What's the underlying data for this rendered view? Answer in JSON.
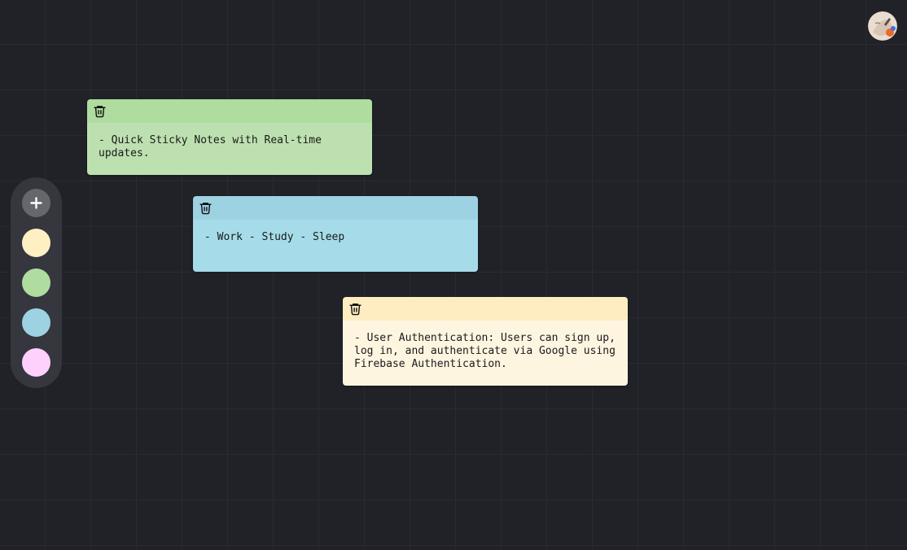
{
  "canvas": {
    "background": "#212227",
    "grid_color": "#2a2b30"
  },
  "avatar": {
    "icon": "user-avatar"
  },
  "sidebar": {
    "add_icon": "plus-icon",
    "colors": [
      {
        "name": "yellow",
        "hex": "#fff0c4"
      },
      {
        "name": "green",
        "hex": "#afdc9f"
      },
      {
        "name": "blue",
        "hex": "#9dd2e3"
      },
      {
        "name": "pink",
        "hex": "#fed1fd"
      }
    ]
  },
  "notes": [
    {
      "id": "note-1",
      "color_name": "green",
      "header_color": "#afdc9f",
      "body_color": "#bde0b0",
      "delete_icon": "trash-icon",
      "text": "- Quick Sticky Notes with Real-time updates."
    },
    {
      "id": "note-2",
      "color_name": "blue",
      "header_color": "#9dd2e3",
      "body_color": "#a6dce9",
      "delete_icon": "trash-icon",
      "text": "- Work - Study - Sleep"
    },
    {
      "id": "note-3",
      "color_name": "yellow",
      "header_color": "#feedc0",
      "body_color": "#fef5e1",
      "delete_icon": "trash-icon",
      "text": "- User Authentication: Users can sign up, log in, and authenticate via Google using Firebase Authentication."
    }
  ]
}
